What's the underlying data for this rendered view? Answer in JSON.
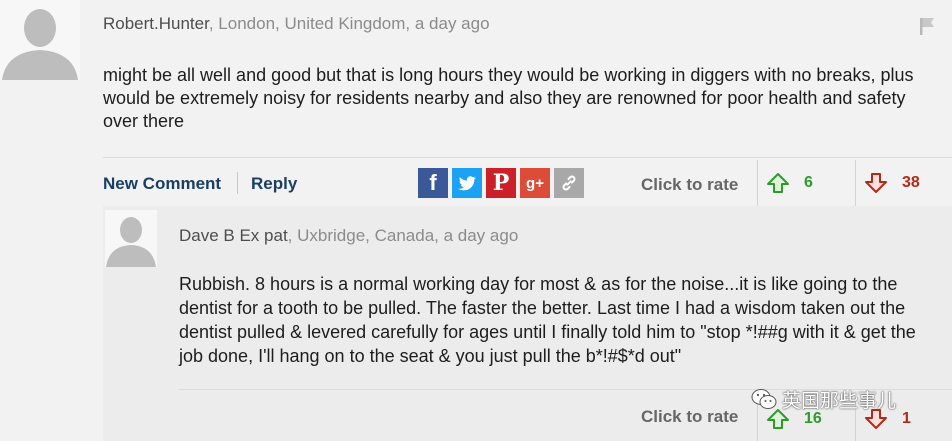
{
  "comment": {
    "author": "Robert.Hunter",
    "meta": ", London, United Kingdom, a day ago",
    "body": "might be all well and good but that is long hours they would be working in diggers with no breaks, plus would be extremely noisy for residents nearby and also they are renowned for poor health and safety over there"
  },
  "actions": {
    "new_comment": "New Comment",
    "reply": "Reply",
    "share_icons": [
      "facebook-icon",
      "twitter-icon",
      "pinterest-icon",
      "google-plus-icon",
      "link-icon"
    ],
    "rate_label": "Click to rate",
    "up_count": "6",
    "down_count": "38"
  },
  "reply": {
    "author": "Dave B Ex pat",
    "meta": ", Uxbridge, Canada, a day ago",
    "body": "Rubbish. 8 hours is a normal working day for most & as for the noise...it is like going to the dentist for a tooth to be pulled. The faster the better. Last time I had a wisdom taken out the dentist pulled & levered carefully for ages until I finally told him to \"stop *!##g with it & get the job done, I'll hang on to the seat & you just pull the b*!#$*d out\"",
    "rate_label": "Click to rate",
    "up_count": "16",
    "down_count": "1"
  },
  "watermark": "英国那些事儿",
  "colors": {
    "link": "#1b3f63",
    "upvote": "#2e9a2e",
    "downvote": "#b22a1a",
    "facebook": "#3b5998",
    "twitter": "#1da1f2",
    "pinterest": "#cb2027",
    "google_plus": "#dd4b39",
    "link_share": "#a8a8a8"
  }
}
